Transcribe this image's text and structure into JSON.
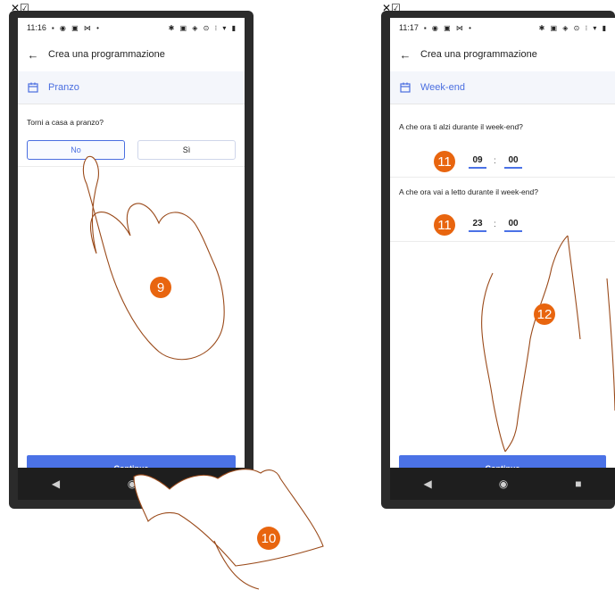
{
  "left_phone": {
    "status_time": "11:16",
    "status_icons": "▪ ◉ ▣ ⋈ •",
    "status_right": "✱ ▣ ◈ ⊙ ⁝ ▾ ▮",
    "title": "Crea una programmazione",
    "section": "Pranzo",
    "question": "Torni a casa a pranzo?",
    "option_no": "No",
    "option_yes": "Sì",
    "cta": "Continua"
  },
  "right_phone": {
    "status_time": "11:17",
    "status_icons": "▪ ◉ ▣ ⋈ •",
    "status_right": "✱ ▣ ◈ ⊙ ⁝ ▾ ▮",
    "title": "Crea una programmazione",
    "section": "Week-end",
    "question_wake": "A che ora ti alzi durante il week-end?",
    "wake_hour": "09",
    "wake_minute": "00",
    "question_sleep": "A che ora vai a letto durante il week-end?",
    "sleep_hour": "23",
    "sleep_minute": "00",
    "cta": "Continua"
  },
  "badges": {
    "b9": "9",
    "b10": "10",
    "b11a": "11",
    "b11b": "11",
    "b12": "12"
  },
  "corner_glyph": "✕☑",
  "colon_char": ":",
  "colors": {
    "accent": "#4b72e6",
    "badge": "#e8650f",
    "frame": "#2b2b2b"
  }
}
